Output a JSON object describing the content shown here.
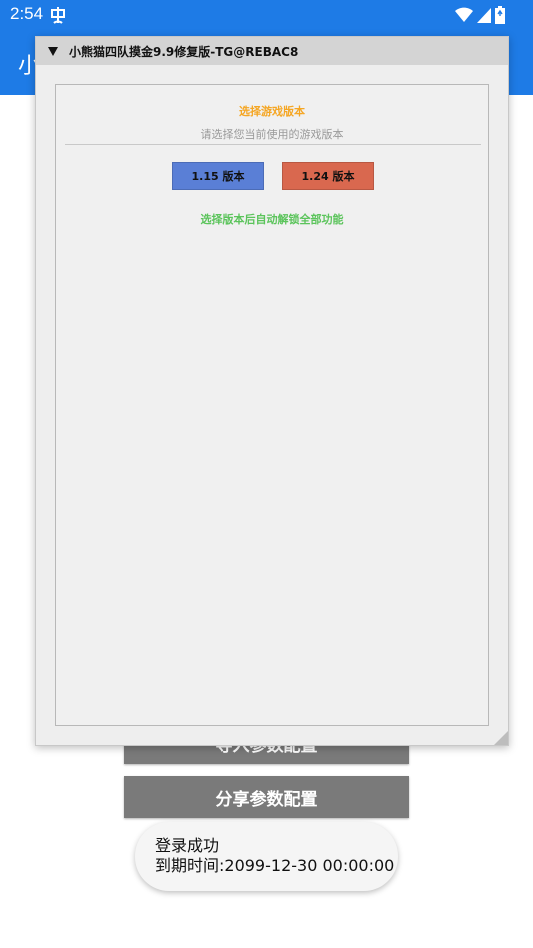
{
  "status_bar": {
    "time": "2:54"
  },
  "app_bar": {
    "title": "小"
  },
  "background": {
    "import_button": "导入参数配置",
    "share_button": "分享参数配置"
  },
  "toast": {
    "line1": "登录成功",
    "line2": "到期时间:2099-12-30 00:00:00"
  },
  "overlay": {
    "title": "小熊猫四队摸金9.9修复版-TG@REBAC8",
    "heading": "选择游戏版本",
    "subheading": "请选择您当前使用的游戏版本",
    "button_115": "1.15 版本",
    "button_124": "1.24 版本",
    "hint": "选择版本后自动解锁全部功能"
  },
  "colors": {
    "accent": "#1e7be6",
    "heading": "#f5a623",
    "hint": "#5bc45b",
    "btn_115": "#5a7fd6",
    "btn_124": "#d9684f"
  }
}
